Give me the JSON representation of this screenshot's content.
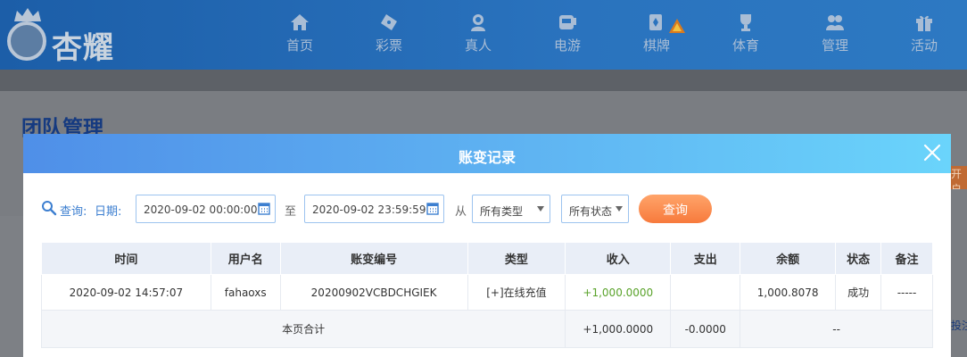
{
  "header": {
    "logo_text": "杏耀",
    "nav": [
      {
        "label": "首页",
        "icon": "home-icon"
      },
      {
        "label": "彩票",
        "icon": "lottery-ticket-icon"
      },
      {
        "label": "真人",
        "icon": "live-dealer-icon"
      },
      {
        "label": "电游",
        "icon": "gamepad-icon"
      },
      {
        "label": "棋牌",
        "icon": "cards-icon"
      },
      {
        "label": "体育",
        "icon": "trophy-icon"
      },
      {
        "label": "管理",
        "icon": "users-icon"
      },
      {
        "label": "活动",
        "icon": "gift-icon"
      }
    ]
  },
  "page": {
    "title": "团队管理",
    "side_tab_text": "开户",
    "side_link_text": "投注"
  },
  "modal": {
    "title": "账变记录",
    "query": {
      "query_label": "查询:",
      "date_label": "日期:",
      "start_date": "2020-09-02 00:00:00",
      "to_label": "至",
      "end_date": "2020-09-02 23:59:59",
      "from_label": "从",
      "type_select": "所有类型",
      "status_select": "所有状态",
      "search_button": "查询"
    },
    "table": {
      "headers": [
        "时间",
        "用户名",
        "账变编号",
        "类型",
        "收入",
        "支出",
        "余额",
        "状态",
        "备注"
      ],
      "rows": [
        {
          "time": "2020-09-02 14:57:07",
          "username": "fahaoxs",
          "serial": "20200902VCBDCHGIEK",
          "type": "[+]在线充值",
          "income": "+1,000.0000",
          "expense": "",
          "balance": "1,000.8078",
          "status": "成功",
          "note": "-----"
        }
      ],
      "total": {
        "label": "本页合计",
        "income": "+1,000.0000",
        "expense": "-0.0000",
        "rest": "--"
      }
    }
  },
  "colors": {
    "nav_bg": "#1c5ea8",
    "modal_header": "#5fb4f2",
    "search_button": "#f77a3c",
    "income_green": "#5aa32b",
    "title_blue": "#153a80"
  }
}
